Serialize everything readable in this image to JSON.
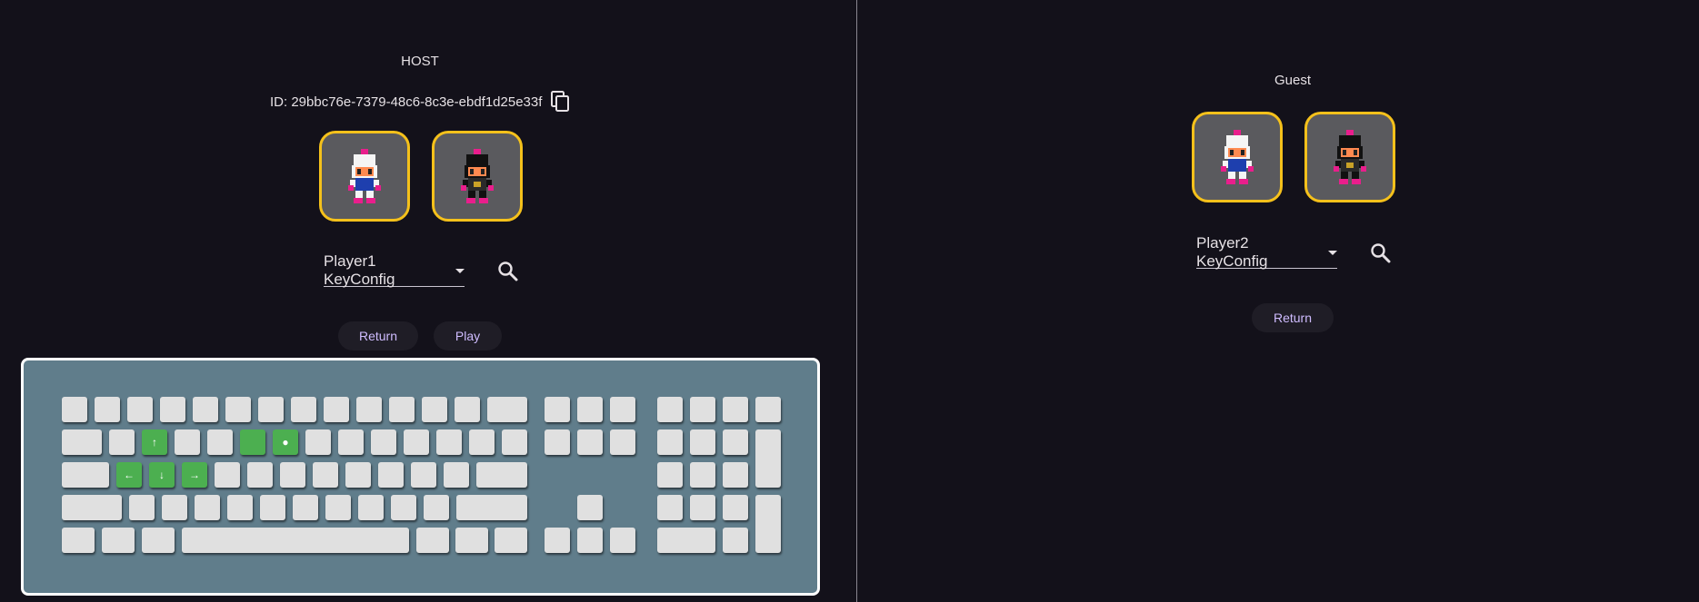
{
  "host": {
    "title": "HOST",
    "id_text": "ID: 29bbc76e-7379-48c6-8c3e-ebdf1d25e33f",
    "characters": [
      {
        "name": "white-bomber",
        "hair": "#f5f5f5"
      },
      {
        "name": "black-bomber",
        "hair": "#111111"
      }
    ],
    "keyconfig_label": "Player1 KeyConfig",
    "return_label": "Return",
    "play_label": "Play"
  },
  "guest": {
    "title": "Guest",
    "characters": [
      {
        "name": "white-bomber",
        "hair": "#f5f5f5"
      },
      {
        "name": "black-bomber",
        "hair": "#111111"
      }
    ],
    "keyconfig_label": "Player2 KeyConfig",
    "return_label": "Return"
  },
  "keyboard": {
    "highlight_color": "#4caf50",
    "key_color": "#e0e0e0",
    "background": "#607d8b",
    "active_keys": [
      {
        "name": "up",
        "glyph": "↑"
      },
      {
        "name": "bomb",
        "glyph": ""
      },
      {
        "name": "action",
        "glyph": "●"
      },
      {
        "name": "left",
        "glyph": "←"
      },
      {
        "name": "down",
        "glyph": "↓"
      },
      {
        "name": "right",
        "glyph": "→"
      }
    ]
  },
  "colors": {
    "accent": "#cfbcff",
    "avatar_border": "#f5c11b",
    "background": "#13111a"
  }
}
